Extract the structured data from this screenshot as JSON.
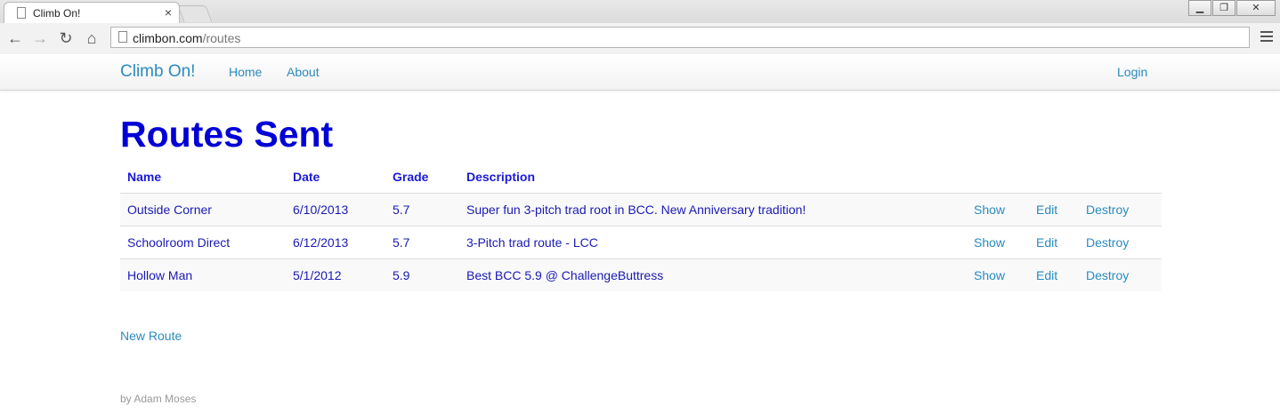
{
  "browser": {
    "tab_title": "Climb On!",
    "tab_close": "×",
    "url_domain": "climbon.com",
    "url_path": "/routes",
    "window_controls": {
      "minimize": "▁",
      "restore": "❐",
      "close": "✕"
    },
    "nav_icons": {
      "back": "←",
      "forward": "→",
      "reload": "↻",
      "home": "⌂"
    }
  },
  "navbar": {
    "brand": "Climb On!",
    "links": [
      "Home",
      "About"
    ],
    "login": "Login"
  },
  "page": {
    "title": "Routes Sent",
    "table": {
      "headers": [
        "Name",
        "Date",
        "Grade",
        "Description"
      ],
      "rows": [
        {
          "name": "Outside Corner",
          "date": "6/10/2013",
          "grade": "5.7",
          "description": "Super fun 3-pitch trad root in BCC. New Anniversary tradition!",
          "show": "Show",
          "edit": "Edit",
          "destroy": "Destroy"
        },
        {
          "name": "Schoolroom Direct",
          "date": "6/12/2013",
          "grade": "5.7",
          "description": "3-Pitch trad route - LCC",
          "show": "Show",
          "edit": "Edit",
          "destroy": "Destroy"
        },
        {
          "name": "Hollow Man",
          "date": "5/1/2012",
          "grade": "5.9",
          "description": "Best BCC 5.9 @ ChallengeButtress",
          "show": "Show",
          "edit": "Edit",
          "destroy": "Destroy"
        }
      ]
    },
    "new_route": "New Route",
    "footer": "by Adam Moses"
  },
  "colors": {
    "link": "#2a8bbf",
    "heading": "#0000d6",
    "table_text": "#1a1ab4"
  }
}
